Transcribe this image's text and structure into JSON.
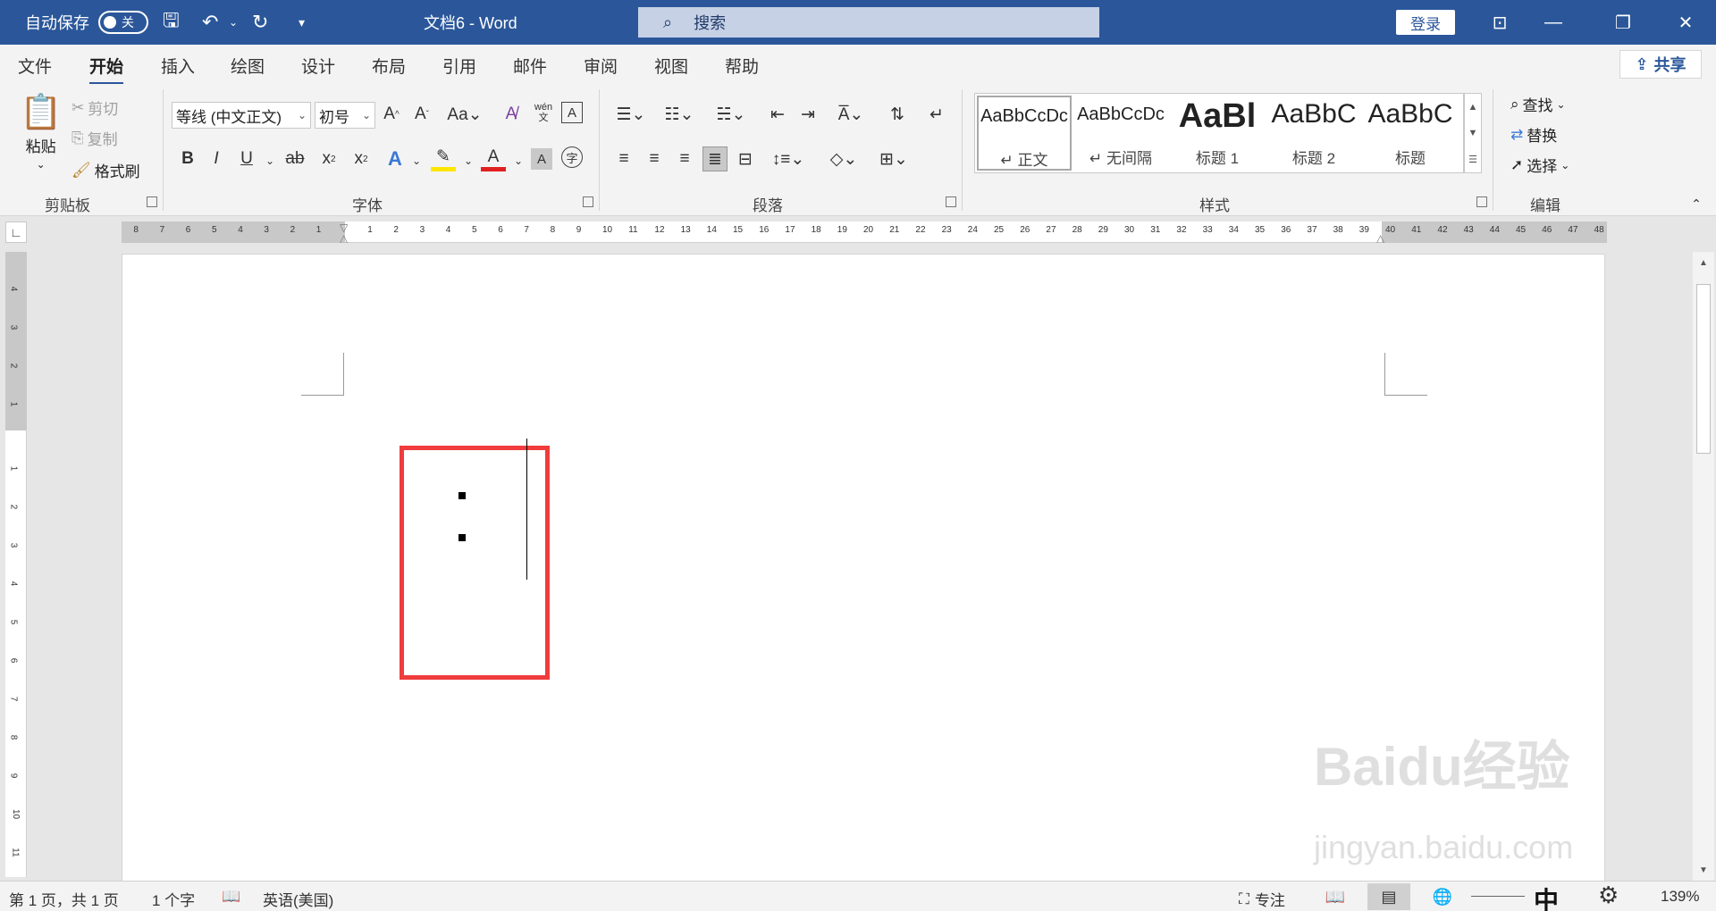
{
  "titlebar": {
    "autosave_label": "自动保存",
    "autosave_state": "关",
    "doc_title": "文档6  -  Word",
    "search_placeholder": "搜索",
    "login_label": "登录"
  },
  "tabs": [
    "文件",
    "开始",
    "插入",
    "绘图",
    "设计",
    "布局",
    "引用",
    "邮件",
    "审阅",
    "视图",
    "帮助"
  ],
  "active_tab": "开始",
  "share_label": "共享",
  "clipboard": {
    "paste": "粘贴",
    "cut": "剪切",
    "copy": "复制",
    "format_painter": "格式刷",
    "group_label": "剪贴板"
  },
  "font": {
    "font_name": "等线 (中文正文)",
    "font_size": "初号",
    "group_label": "字体",
    "pinyin_label": "wén"
  },
  "paragraph": {
    "group_label": "段落"
  },
  "styles": {
    "group_label": "样式",
    "items": [
      {
        "sample": "AaBbCcDc",
        "name": "↵ 正文"
      },
      {
        "sample": "AaBbCcDc",
        "name": "↵ 无间隔"
      },
      {
        "sample": "AaBl",
        "name": "标题 1"
      },
      {
        "sample": "AaBbC",
        "name": "标题 2"
      },
      {
        "sample": "AaBbC",
        "name": "标题"
      }
    ]
  },
  "editing": {
    "find": "查找",
    "replace": "替换",
    "select": "选择",
    "group_label": "编辑"
  },
  "ruler": {
    "left_numbers": [
      "8",
      "7",
      "6",
      "5",
      "4",
      "3",
      "2",
      "1"
    ],
    "right_numbers": [
      "1",
      "2",
      "3",
      "4",
      "5",
      "6",
      "7",
      "8",
      "9",
      "10",
      "11",
      "12",
      "13",
      "14",
      "15",
      "16",
      "17",
      "18",
      "19",
      "20",
      "21",
      "22",
      "23",
      "24",
      "25",
      "26",
      "27",
      "28",
      "29",
      "30",
      "31",
      "32",
      "33",
      "34",
      "35",
      "36",
      "37",
      "38",
      "39",
      "40",
      "41",
      "42",
      "43",
      "44",
      "45",
      "46",
      "47",
      "48"
    ],
    "vertical_top": [
      "4",
      "3",
      "2",
      "1"
    ],
    "vertical_bottom": [
      "1",
      "2",
      "3",
      "4",
      "5",
      "6",
      "7",
      "8",
      "9",
      "10",
      "11"
    ]
  },
  "statusbar": {
    "page": "第 1 页，共 1 页",
    "words": "1 个字",
    "language": "英语(美国)",
    "focus": "专注",
    "ime": "中",
    "zoom": "139%"
  },
  "watermark": {
    "line1": "Baidu经验",
    "line2": "jingyan.baidu.com"
  },
  "colors": {
    "titlebar": "#2b579a",
    "highlight_box": "#f03c3c"
  }
}
